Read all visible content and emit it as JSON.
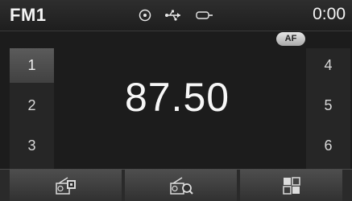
{
  "status_bar": {
    "band": "FM1",
    "time": "0:00",
    "icons": [
      "disc-icon",
      "usb-icon",
      "aux-icon"
    ]
  },
  "af_badge": "AF",
  "presets": {
    "left": [
      "1",
      "2",
      "3"
    ],
    "right": [
      "4",
      "5",
      "6"
    ],
    "selected": "1"
  },
  "frequency": "87.50",
  "softkeys": [
    {
      "icon": "radio-presets-icon"
    },
    {
      "icon": "radio-scan-icon"
    },
    {
      "icon": "menu-grid-icon"
    }
  ],
  "colors": {
    "background": "#1c1c1c",
    "text": "#f4f4f4",
    "active_preset": "#4e4e4e"
  }
}
